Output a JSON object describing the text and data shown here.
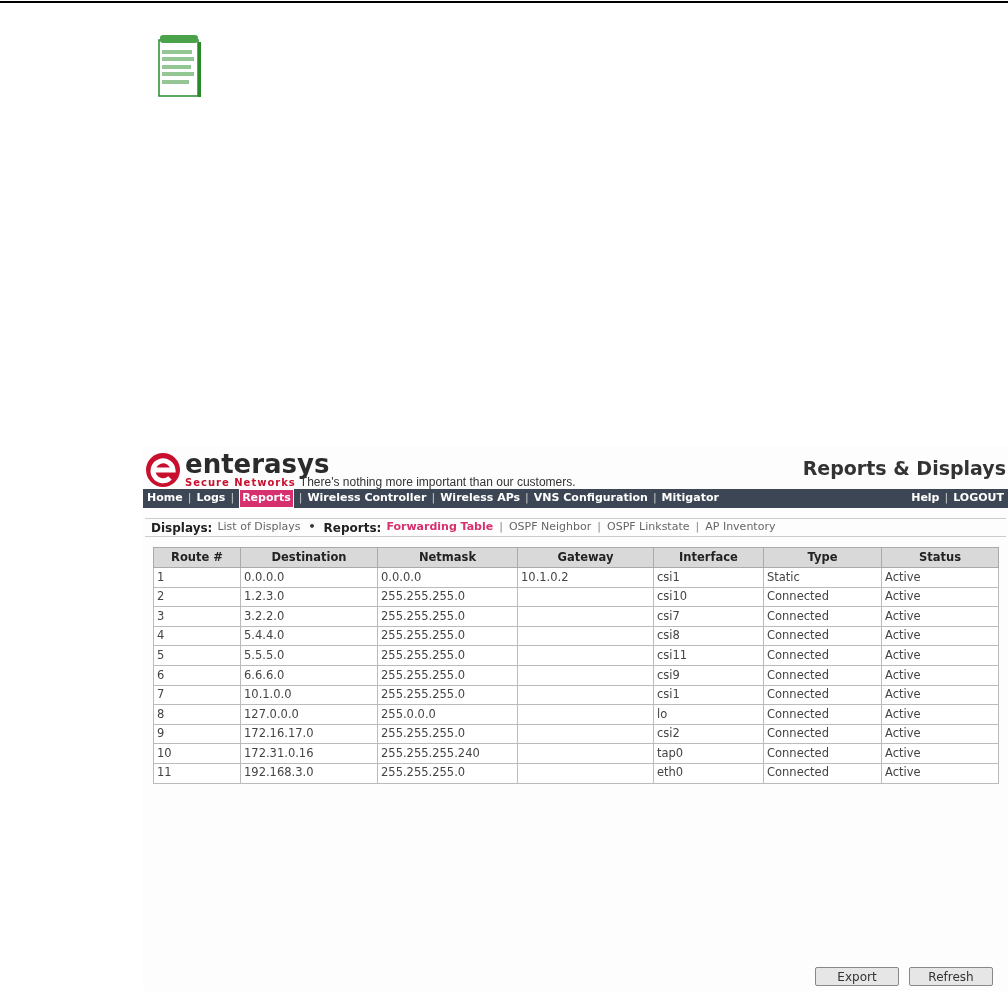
{
  "brand": {
    "name": "enterasys",
    "tagline": "Secure Networks",
    "slogan": "There's nothing more important than our customers."
  },
  "page_title": "Reports & Displays",
  "nav": {
    "items": [
      {
        "label": "Home",
        "selected": false
      },
      {
        "label": "Logs",
        "selected": false
      },
      {
        "label": "Reports",
        "selected": true
      },
      {
        "label": "Wireless Controller",
        "selected": false
      },
      {
        "label": "Wireless APs",
        "selected": false
      },
      {
        "label": "VNS Configuration",
        "selected": false
      },
      {
        "label": "Mitigator",
        "selected": false
      }
    ],
    "right_items": [
      "Help",
      "LOGOUT"
    ],
    "separator": "|"
  },
  "subnav": {
    "separator": "|",
    "bullet": "•",
    "groups": [
      {
        "label": "Displays:",
        "links": [
          {
            "label": "List of Displays",
            "selected": false
          }
        ]
      },
      {
        "label": "Reports:",
        "links": [
          {
            "label": "Forwarding Table",
            "selected": true
          },
          {
            "label": "OSPF Neighbor",
            "selected": false
          },
          {
            "label": "OSPF Linkstate",
            "selected": false
          },
          {
            "label": "AP Inventory",
            "selected": false
          }
        ]
      }
    ]
  },
  "table": {
    "columns": [
      "Route #",
      "Destination",
      "Netmask",
      "Gateway",
      "Interface",
      "Type",
      "Status"
    ],
    "rows": [
      [
        "1",
        "0.0.0.0",
        "0.0.0.0",
        "10.1.0.2",
        "csi1",
        "Static",
        "Active"
      ],
      [
        "2",
        "1.2.3.0",
        "255.255.255.0",
        "",
        "csi10",
        "Connected",
        "Active"
      ],
      [
        "3",
        "3.2.2.0",
        "255.255.255.0",
        "",
        "csi7",
        "Connected",
        "Active"
      ],
      [
        "4",
        "5.4.4.0",
        "255.255.255.0",
        "",
        "csi8",
        "Connected",
        "Active"
      ],
      [
        "5",
        "5.5.5.0",
        "255.255.255.0",
        "",
        "csi11",
        "Connected",
        "Active"
      ],
      [
        "6",
        "6.6.6.0",
        "255.255.255.0",
        "",
        "csi9",
        "Connected",
        "Active"
      ],
      [
        "7",
        "10.1.0.0",
        "255.255.255.0",
        "",
        "csi1",
        "Connected",
        "Active"
      ],
      [
        "8",
        "127.0.0.0",
        "255.0.0.0",
        "",
        "lo",
        "Connected",
        "Active"
      ],
      [
        "9",
        "172.16.17.0",
        "255.255.255.0",
        "",
        "csi2",
        "Connected",
        "Active"
      ],
      [
        "10",
        "172.31.0.16",
        "255.255.255.240",
        "",
        "tap0",
        "Connected",
        "Active"
      ],
      [
        "11",
        "192.168.3.0",
        "255.255.255.0",
        "",
        "eth0",
        "Connected",
        "Active"
      ]
    ]
  },
  "buttons": [
    "Export",
    "Refresh"
  ]
}
